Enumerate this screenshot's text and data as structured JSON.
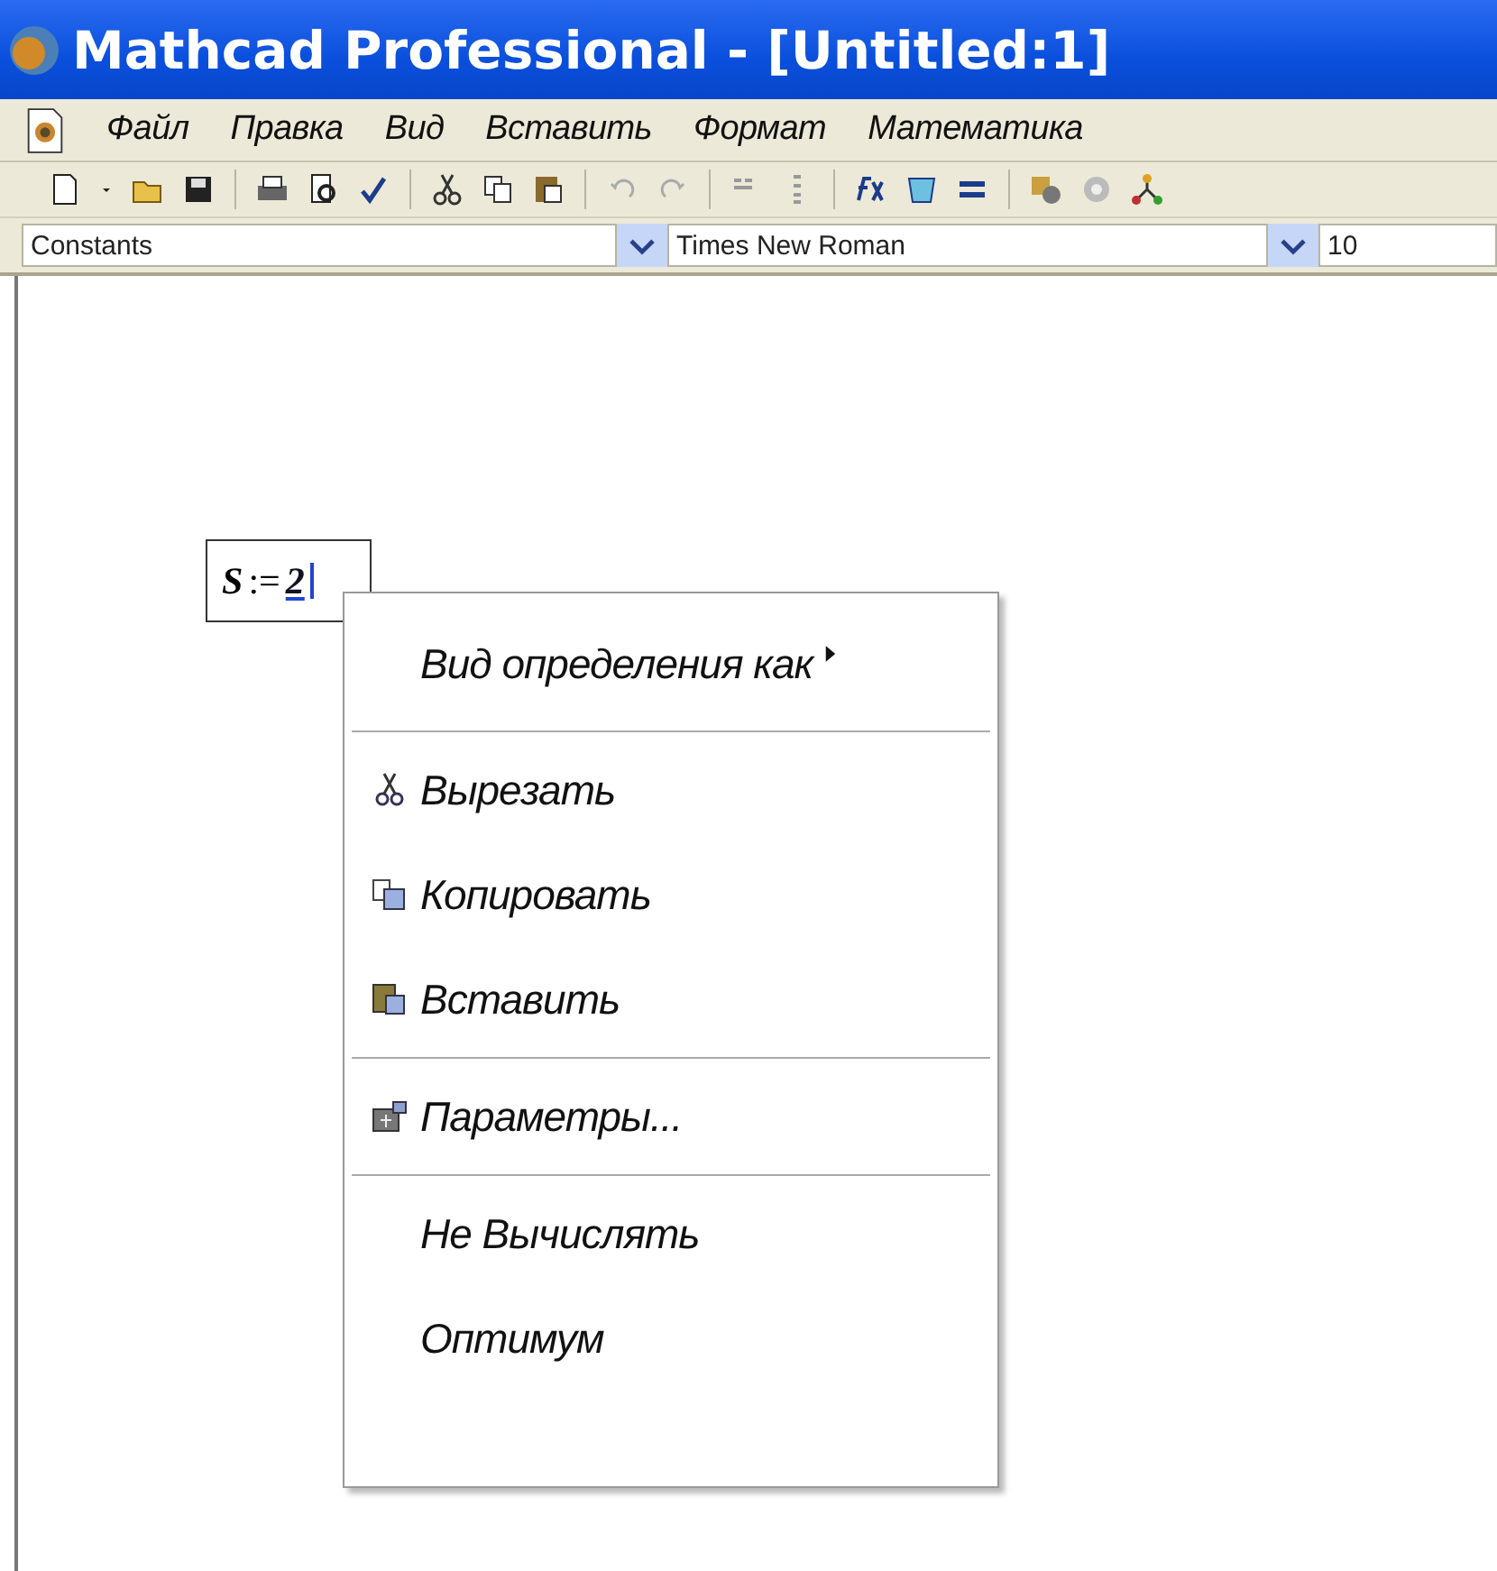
{
  "window": {
    "title": "Mathcad Professional - [Untitled:1]"
  },
  "menu_bar": {
    "items": [
      "Файл",
      "Правка",
      "Вид",
      "Вставить",
      "Формат",
      "Математика"
    ]
  },
  "format_bar": {
    "style": "Constants",
    "font": "Times New Roman",
    "size": "10"
  },
  "worksheet": {
    "math": {
      "variable": "S",
      "operator": ":=",
      "value": "2"
    }
  },
  "context_menu": {
    "groups": [
      [
        {
          "label": "Вид определения как",
          "kind": "submenu"
        }
      ],
      [
        {
          "label": "Вырезать",
          "kind": "icon_item"
        },
        {
          "label": "Копировать",
          "kind": "icon_item"
        },
        {
          "label": "Вставить",
          "kind": "icon_item"
        }
      ],
      [
        {
          "label": "Параметры...",
          "kind": "icon_item"
        }
      ],
      [
        {
          "label": "Не Вычислять",
          "kind": "plain"
        },
        {
          "label": "Оптимум",
          "kind": "plain"
        }
      ]
    ]
  }
}
